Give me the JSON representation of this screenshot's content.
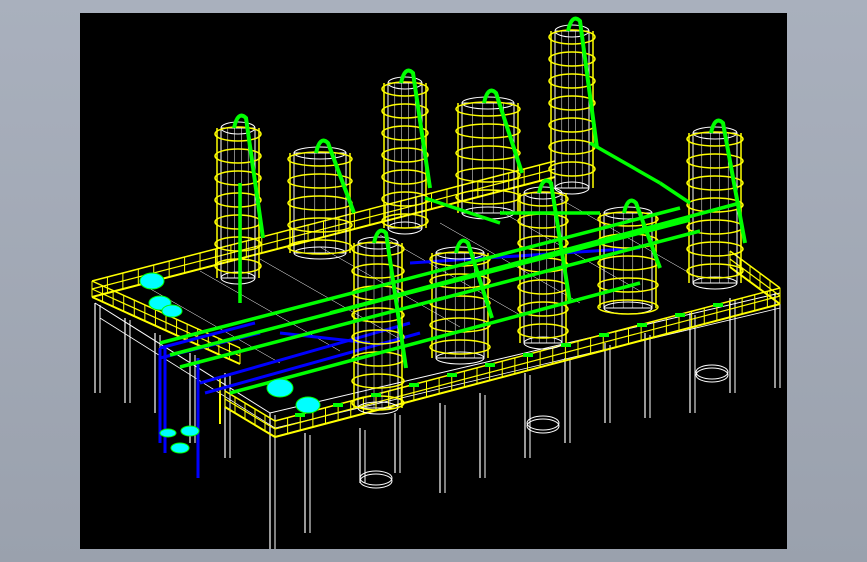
{
  "app": {
    "view": "cad-3d-viewport",
    "background": "#000000",
    "surround": "#9ea5b1"
  },
  "colors": {
    "structure": "#ffffff",
    "platform": "#ffff00",
    "pipe": "#00ff00",
    "pipe_blue": "#0000ff",
    "equipment": "#00ffff",
    "vessel": "#ffffff"
  },
  "model": {
    "towers": [
      "tower",
      "tower",
      "tower",
      "tower",
      "tower",
      "tower",
      "tower",
      "tower",
      "tower",
      "tower"
    ]
  }
}
